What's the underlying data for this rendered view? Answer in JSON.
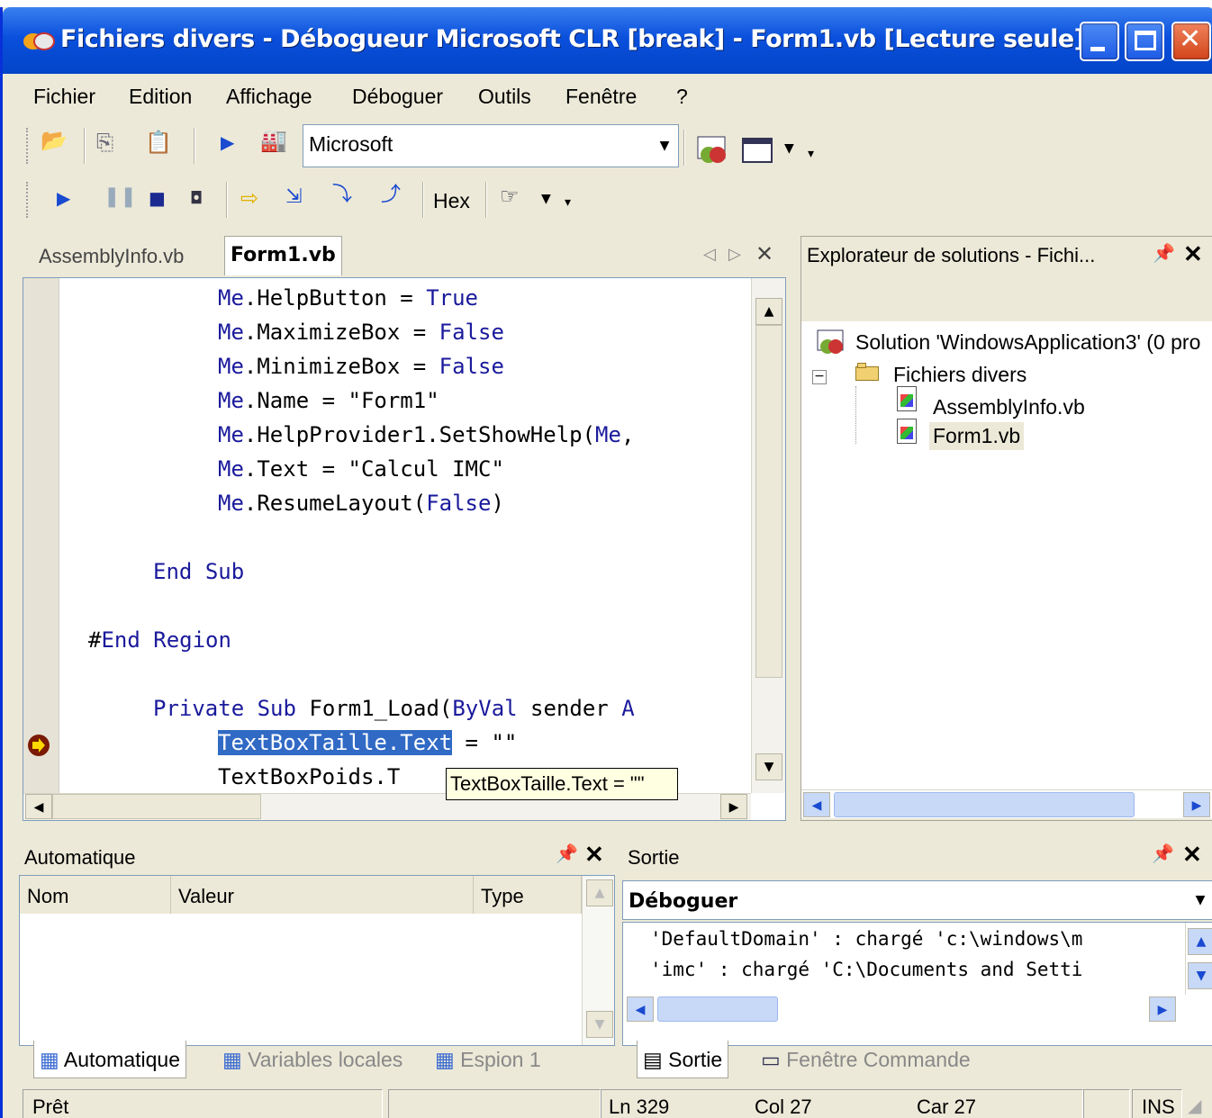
{
  "window": {
    "title": "Fichiers divers - Débogueur Microsoft CLR [break] - Form1.vb [Lecture seule]"
  },
  "menu": [
    "Fichier",
    "Edition",
    "Affichage",
    "Déboguer",
    "Outils",
    "Fenêtre",
    "?"
  ],
  "toolbar": {
    "combo_value": "Microsoft",
    "hex_label": "Hex"
  },
  "editor": {
    "tabs": [
      "AssemblyInfo.vb",
      "Form1.vb"
    ],
    "active_tab": "Form1.vb",
    "lines": [
      {
        "pre": "Me",
        "dot": ".HelpButton = ",
        "kw": "True",
        "post": ""
      },
      {
        "pre": "Me",
        "dot": ".MaximizeBox = ",
        "kw": "False",
        "post": ""
      },
      {
        "pre": "Me",
        "dot": ".MinimizeBox = ",
        "kw": "False",
        "post": ""
      },
      {
        "pre": "Me",
        "dot": ".Name = \"Form1\"",
        "kw": "",
        "post": ""
      },
      {
        "pre": "Me",
        "dot": ".HelpProvider1.SetShowHelp(",
        "kw": "Me",
        "post": ","
      },
      {
        "pre": "Me",
        "dot": ".Text = \"Calcul IMC\"",
        "kw": "",
        "post": ""
      },
      {
        "pre": "Me",
        "dot": ".ResumeLayout(",
        "kw": "False",
        "post": ")"
      }
    ],
    "end_sub_1": "End",
    "end_sub_2": "Sub",
    "end_region_hash": "#",
    "end_region_kw": "End Region",
    "private_kw": "Private Sub",
    "private_rest": " Form1_Load(",
    "byval_kw": "ByVal",
    "private_tail": " sender ",
    "private_tail_kw": "A",
    "current_line_sel": "TextBoxTaille.Text",
    "current_line_rest": " = \"\"",
    "next_line": "TextBoxPoids.T",
    "tooltip": "TextBoxTaille.Text = \"\""
  },
  "solution_explorer": {
    "title": "Explorateur de solutions - Fichi...",
    "solution": "Solution 'WindowsApplication3' (0 pro",
    "folder": "Fichiers divers",
    "files": [
      "AssemblyInfo.vb",
      "Form1.vb"
    ]
  },
  "auto_pane": {
    "title": "Automatique",
    "columns": [
      "Nom",
      "Valeur",
      "Type"
    ],
    "tabs": [
      "Automatique",
      "Variables locales",
      "Espion 1"
    ]
  },
  "sortie_pane": {
    "title": "Sortie",
    "dropdown": "Déboguer",
    "lines": [
      "'DefaultDomain' : chargé 'c:\\windows\\m",
      "'imc' : chargé 'C:\\Documents and Setti"
    ],
    "tabs": [
      "Sortie",
      "Fenêtre Commande"
    ]
  },
  "status": {
    "text": "Prêt",
    "ln": "Ln 329",
    "col": "Col 27",
    "car": "Car 27",
    "ins": "INS"
  }
}
